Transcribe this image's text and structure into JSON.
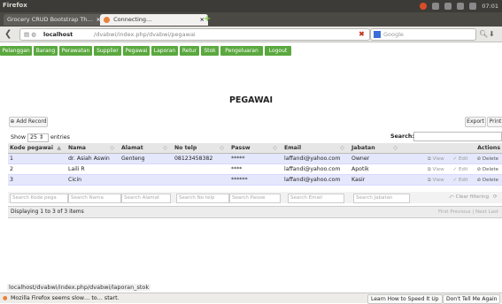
{
  "os": {
    "window_title": "Firefox",
    "clock": "07:01"
  },
  "browser": {
    "tabs": [
      {
        "label": "Grocery CRUD Bootstrap Th…",
        "active": false
      },
      {
        "label": "Connecting…",
        "active": true
      }
    ],
    "url_host": "localhost",
    "url_path": "/dvabwi/index.php/dvabwi/pegawai",
    "search_placeholder": "Google"
  },
  "menu": {
    "items": [
      "Pelanggan",
      "Barang",
      "Perawatan",
      "Supplier",
      "Pegawai",
      "Laporan",
      "Retur",
      "Stok",
      "Pengeluaran",
      "Logout"
    ]
  },
  "page": {
    "title": "PEGAWAI",
    "add_record": "Add Record",
    "export": "Export",
    "print": "Print",
    "show_prefix": "Show",
    "show_value": "25",
    "show_suffix": "entries",
    "search_label": "Search:"
  },
  "table": {
    "columns": [
      "Kode pegawai",
      "Nama",
      "Alamat",
      "No telp",
      "Passw",
      "Email",
      "Jabatan",
      "",
      "Actions"
    ],
    "rows": [
      {
        "kode": "1",
        "nama": "dr. Asiah Aswin",
        "alamat": "Genteng",
        "telp": "08123458382",
        "passw": "*****",
        "email": "laffandi@yahoo.com",
        "jabatan": "Owner"
      },
      {
        "kode": "2",
        "nama": "Laili R",
        "alamat": "",
        "telp": "",
        "passw": "****",
        "email": "laffandi@yahoo.com",
        "jabatan": "Apotik"
      },
      {
        "kode": "3",
        "nama": "Cicin",
        "alamat": "",
        "telp": "",
        "passw": "******",
        "email": "laffandi@yahoo.com",
        "jabatan": "Kasir"
      }
    ],
    "action_labels": {
      "view": "View",
      "edit": "Edit",
      "delete": "Delete"
    },
    "filters": [
      "Search Kode pega",
      "Search Nama",
      "Search Alamat",
      "Search No telp",
      "Search Passw",
      "Search Email",
      "Search Jabatan"
    ],
    "clear_filtering": "Clear filtering",
    "displaying": "Displaying 1 to 3 of 3 items",
    "pager": [
      "First",
      "Previous",
      "Next",
      "Last"
    ]
  },
  "status": {
    "hover_url": "localhost/dvabwi/index.php/dvabwi/laporan_stok",
    "message": "Mozilla Firefox seems slow… to… start.",
    "learn_button": "Learn How to Speed It Up",
    "dont_tell": "Don't Tell Me Again"
  }
}
